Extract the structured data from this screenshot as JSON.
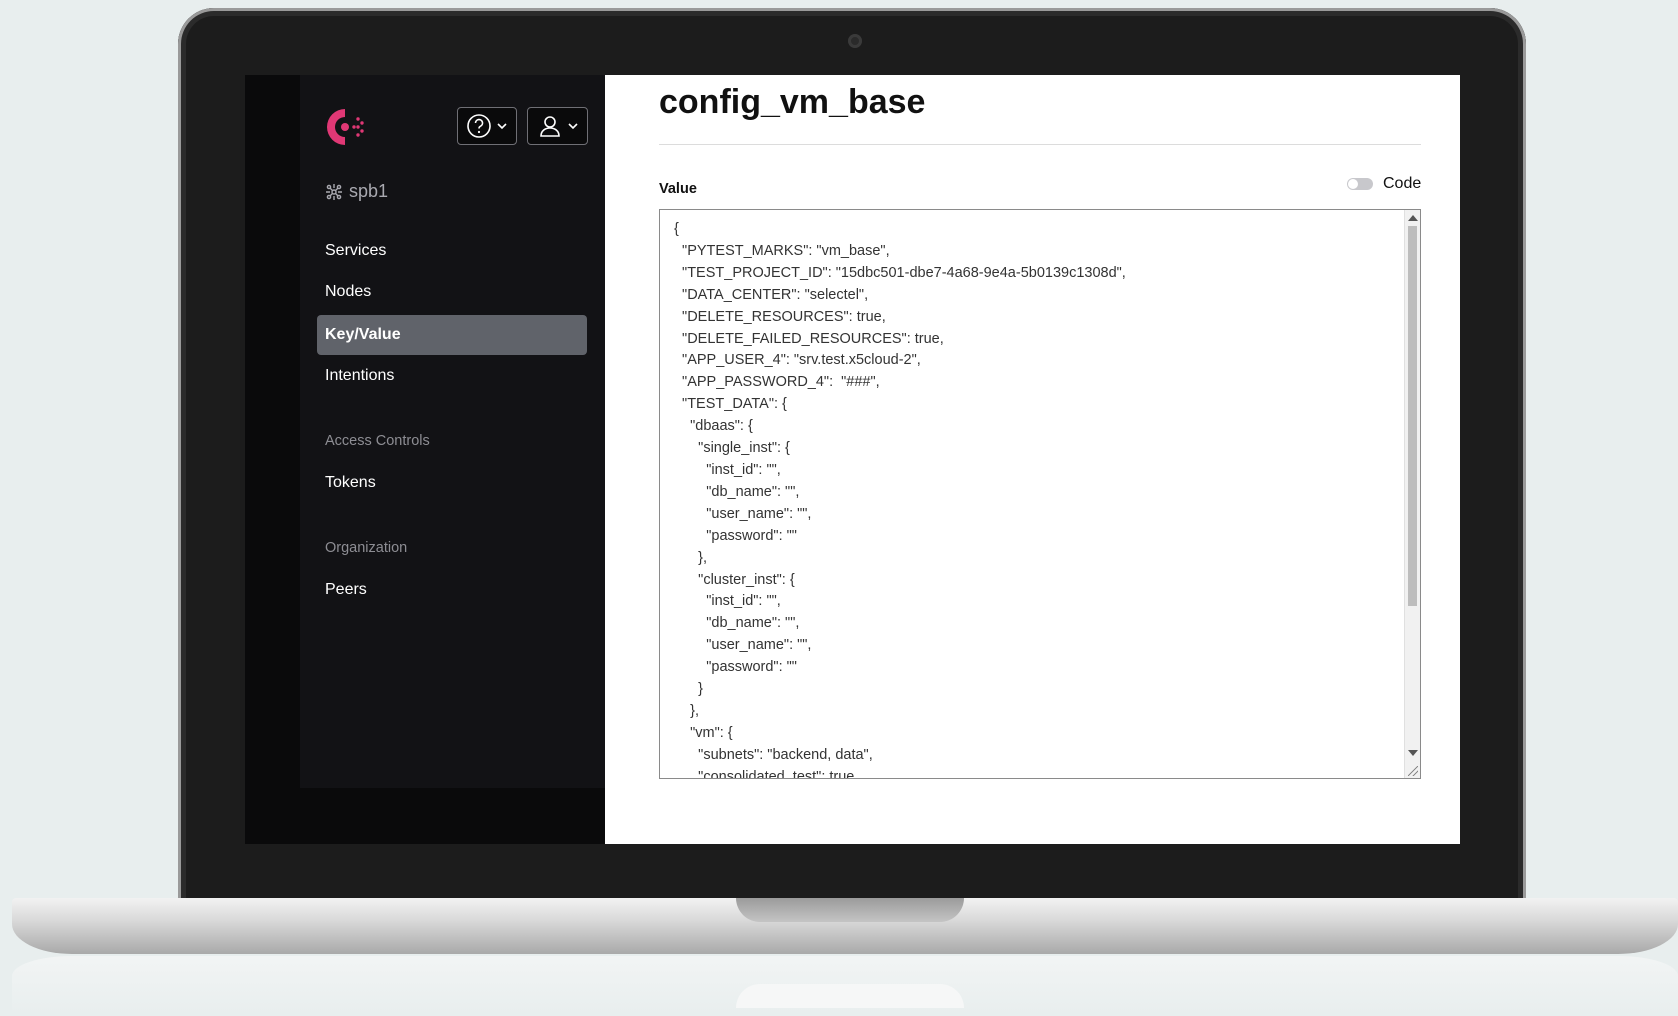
{
  "app": {
    "datacenter": "spb1"
  },
  "sidebar": {
    "items": [
      {
        "label": "Services",
        "active": false
      },
      {
        "label": "Nodes",
        "active": false
      },
      {
        "label": "Key/Value",
        "active": true
      },
      {
        "label": "Intentions",
        "active": false
      }
    ],
    "access_controls_heading": "Access Controls",
    "access_items": [
      {
        "label": "Tokens"
      }
    ],
    "organization_heading": "Organization",
    "organization_items": [
      {
        "label": "Peers"
      }
    ]
  },
  "main": {
    "title": "config_vm_base",
    "value_label": "Value",
    "code_toggle_label": "Code",
    "code_toggle_on": false,
    "editor_value": "{\n  \"PYTEST_MARKS\": \"vm_base\",\n  \"TEST_PROJECT_ID\": \"15dbc501-dbe7-4a68-9e4a-5b0139c1308d\",\n  \"DATA_CENTER\": \"selectel\",\n  \"DELETE_RESOURCES\": true,\n  \"DELETE_FAILED_RESOURCES\": true,\n  \"APP_USER_4\": \"srv.test.x5cloud-2\",\n  \"APP_PASSWORD_4\":  \"###\",\n  \"TEST_DATA\": {\n    \"dbaas\": {\n      \"single_inst\": {\n        \"inst_id\": \"\",\n        \"db_name\": \"\",\n        \"user_name\": \"\",\n        \"password\": \"\"\n      },\n      \"cluster_inst\": {\n        \"inst_id\": \"\",\n        \"db_name\": \"\",\n        \"user_name\": \"\",\n        \"password\": \"\"\n      }\n    },\n    \"vm\": {\n      \"subnets\": \"backend, data\",\n      \"consolidated_test\": true"
  },
  "colors": {
    "brand": "#e03875",
    "sidebar_bg": "#0a0a0b",
    "active_item_bg": "#60636a"
  },
  "icons": {
    "logo": "consul-logo",
    "help": "help-icon",
    "user": "user-icon",
    "datacenter": "datacenter-icon"
  }
}
